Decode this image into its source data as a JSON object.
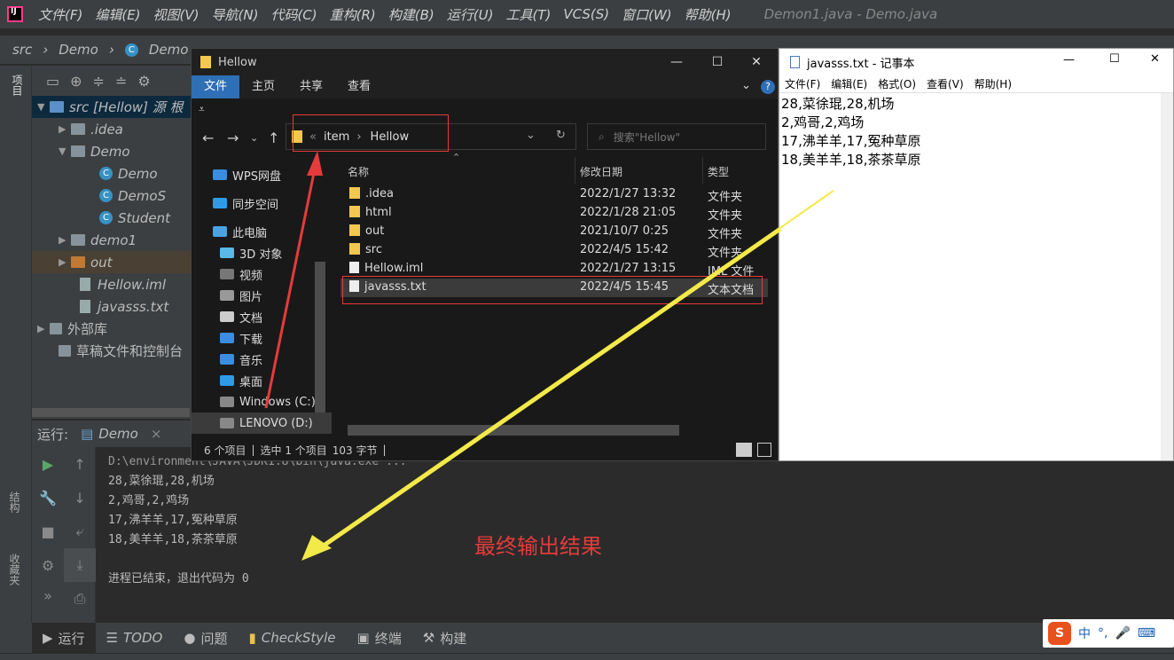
{
  "ide": {
    "menu": [
      "文件(F)",
      "编辑(E)",
      "视图(V)",
      "导航(N)",
      "代码(C)",
      "重构(R)",
      "构建(B)",
      "运行(U)",
      "工具(T)",
      "VCS(S)",
      "窗口(W)",
      "帮助(H)"
    ],
    "window_title": "Demon1.java - Demo.java",
    "breadcrumb": [
      "src",
      "Demo",
      "Demo"
    ],
    "left_strip_label": "项目",
    "project_tree": [
      {
        "label": "src [Hellow] 源 根",
        "indent": 0
      },
      {
        "label": ".idea",
        "indent": 1
      },
      {
        "label": "Demo",
        "indent": 1
      },
      {
        "label": "Demo",
        "indent": 2
      },
      {
        "label": "DemoS",
        "indent": 2
      },
      {
        "label": "Student",
        "indent": 2
      },
      {
        "label": "demo1",
        "indent": 1
      },
      {
        "label": "out",
        "indent": 1
      },
      {
        "label": "Hellow.iml",
        "indent": 1
      },
      {
        "label": "javasss.txt",
        "indent": 1
      },
      {
        "label": "外部库",
        "indent": 0
      },
      {
        "label": "草稿文件和控制台",
        "indent": 0
      }
    ],
    "run": {
      "label": "运行:",
      "tab": "Demo",
      "console": [
        "D:\\environment\\JAVA\\JDK1.8\\bin\\java.exe ...",
        "28,菜徐琨,28,机场",
        "2,鸡哥,2,鸡场",
        "17,沸羊羊,17,冤种草原",
        "18,美羊羊,18,茶茶草原",
        "",
        "进程已结束，退出代码为 0"
      ]
    },
    "annotation": "最终输出结果",
    "side_labels": [
      "结构",
      "收藏夹"
    ],
    "statusbar": [
      "运行",
      "TODO",
      "问题",
      "CheckStyle",
      "终端",
      "构建"
    ]
  },
  "explorer": {
    "title": "Hellow",
    "ribbon_tabs": [
      "文件",
      "主页",
      "共享",
      "查看"
    ],
    "address": [
      "item",
      "Hellow"
    ],
    "search_placeholder": "搜索\"Hellow\"",
    "nav": [
      "WPS网盘",
      "同步空间",
      "此电脑",
      "3D 对象",
      "视频",
      "图片",
      "文档",
      "下载",
      "音乐",
      "桌面",
      "Windows (C:)",
      "LENOVO (D:)"
    ],
    "columns": [
      "名称",
      "修改日期",
      "类型"
    ],
    "files": [
      {
        "name": ".idea",
        "date": "2022/1/27 13:32",
        "type": "文件夹",
        "kind": "folder"
      },
      {
        "name": "html",
        "date": "2022/1/28 21:05",
        "type": "文件夹",
        "kind": "folder"
      },
      {
        "name": "out",
        "date": "2021/10/7 0:25",
        "type": "文件夹",
        "kind": "folder"
      },
      {
        "name": "src",
        "date": "2022/4/5 15:42",
        "type": "文件夹",
        "kind": "folder"
      },
      {
        "name": "Hellow.iml",
        "date": "2022/1/27 13:15",
        "type": "IML 文件",
        "kind": "file"
      },
      {
        "name": "javasss.txt",
        "date": "2022/4/5 15:45",
        "type": "文本文档",
        "kind": "file"
      }
    ],
    "status": [
      "6 个项目",
      "|",
      "选中 1 个项目",
      "103 字节",
      "|"
    ]
  },
  "notepad": {
    "title": "javasss.txt - 记事本",
    "menu": [
      "文件(F)",
      "编辑(E)",
      "格式(O)",
      "查看(V)",
      "帮助(H)"
    ],
    "lines": [
      "28,菜徐琨,28,机场",
      "2,鸡哥,2,鸡场",
      "17,沸羊羊,17,冤种草原",
      "18,美羊羊,18,茶茶草原"
    ]
  },
  "ime": {
    "lang": "中",
    "punct": "°,"
  }
}
